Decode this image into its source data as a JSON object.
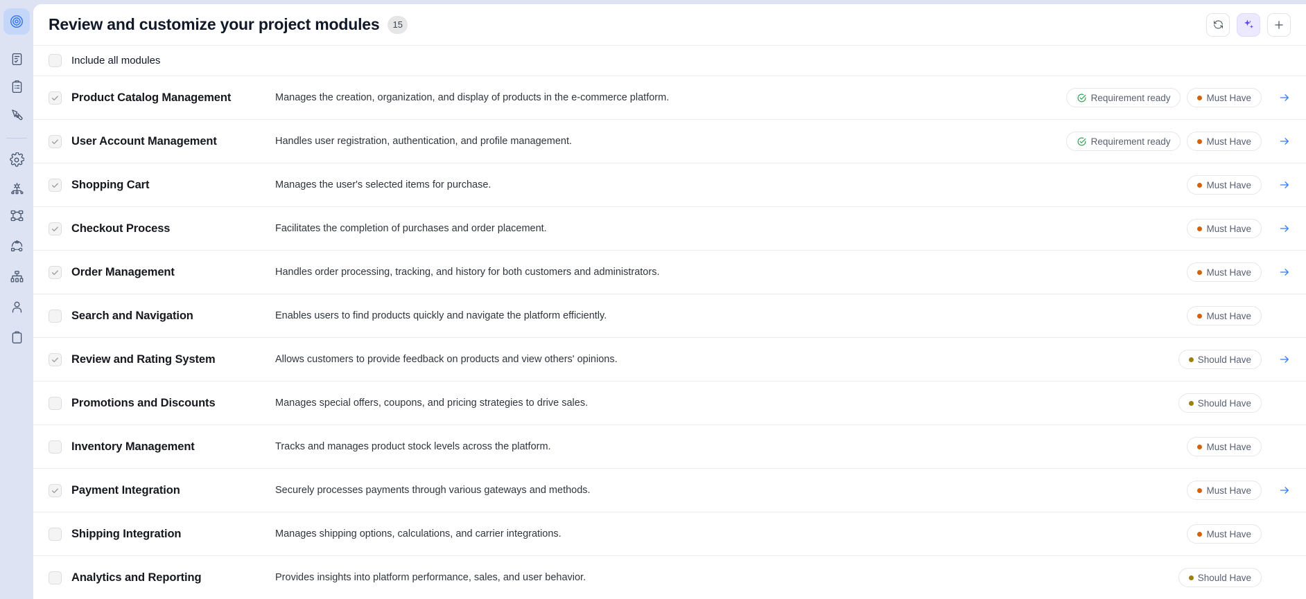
{
  "sidebar": {
    "items": [
      {
        "name": "target-icon",
        "label": "Project Overview",
        "active": true
      },
      {
        "name": "document-check-icon",
        "label": "Requirements",
        "active": false
      },
      {
        "name": "clipboard-list-icon",
        "label": "Tasks",
        "active": false
      },
      {
        "name": "design-pen-icon",
        "label": "Design",
        "active": false
      },
      {
        "name": "gear-icon",
        "label": "Settings",
        "active": false
      },
      {
        "name": "gear-network-icon",
        "label": "Integrations",
        "active": false
      },
      {
        "name": "sitemap-icon",
        "label": "Architecture",
        "active": false
      },
      {
        "name": "shapes-flow-icon",
        "label": "Workflow",
        "active": false
      },
      {
        "name": "org-chart-icon",
        "label": "Hierarchy",
        "active": false
      },
      {
        "name": "user-icon",
        "label": "Account",
        "active": false
      },
      {
        "name": "clipboard-icon",
        "label": "Notes",
        "active": false
      }
    ]
  },
  "header": {
    "title": "Review and customize your project modules",
    "count": "15",
    "actions": [
      {
        "name": "refresh-button",
        "icon": "refresh-icon",
        "label": "Regenerate",
        "accent": false
      },
      {
        "name": "ai-button",
        "icon": "sparkles-icon",
        "label": "AI assist",
        "accent": true
      },
      {
        "name": "add-button",
        "icon": "plus-icon",
        "label": "Add module",
        "accent": false
      }
    ]
  },
  "select_all": {
    "label": "Include all modules",
    "checked": false
  },
  "priority_colors": {
    "must_have": "#d3620e",
    "should_have": "#9c7f10",
    "ready_check": "#2e9e4f"
  },
  "modules": [
    {
      "name": "Product Catalog Management",
      "description": "Manages the creation, organization, and display of products in the e-commerce platform.",
      "checked": true,
      "status": "Requirement ready",
      "priority": "Must Have",
      "priority_kind": "must",
      "has_arrow": true
    },
    {
      "name": "User Account Management",
      "description": "Handles user registration, authentication, and profile management.",
      "checked": true,
      "status": "Requirement ready",
      "priority": "Must Have",
      "priority_kind": "must",
      "has_arrow": true
    },
    {
      "name": "Shopping Cart",
      "description": "Manages the user's selected items for purchase.",
      "checked": true,
      "status": "",
      "priority": "Must Have",
      "priority_kind": "must",
      "has_arrow": true
    },
    {
      "name": "Checkout Process",
      "description": "Facilitates the completion of purchases and order placement.",
      "checked": true,
      "status": "",
      "priority": "Must Have",
      "priority_kind": "must",
      "has_arrow": true
    },
    {
      "name": "Order Management",
      "description": "Handles order processing, tracking, and history for both customers and administrators.",
      "checked": true,
      "status": "",
      "priority": "Must Have",
      "priority_kind": "must",
      "has_arrow": true
    },
    {
      "name": "Search and Navigation",
      "description": "Enables users to find products quickly and navigate the platform efficiently.",
      "checked": false,
      "status": "",
      "priority": "Must Have",
      "priority_kind": "must",
      "has_arrow": false
    },
    {
      "name": "Review and Rating System",
      "description": "Allows customers to provide feedback on products and view others' opinions.",
      "checked": true,
      "status": "",
      "priority": "Should Have",
      "priority_kind": "should",
      "has_arrow": true
    },
    {
      "name": "Promotions and Discounts",
      "description": "Manages special offers, coupons, and pricing strategies to drive sales.",
      "checked": false,
      "status": "",
      "priority": "Should Have",
      "priority_kind": "should",
      "has_arrow": false
    },
    {
      "name": "Inventory Management",
      "description": "Tracks and manages product stock levels across the platform.",
      "checked": false,
      "status": "",
      "priority": "Must Have",
      "priority_kind": "must",
      "has_arrow": false
    },
    {
      "name": "Payment Integration",
      "description": "Securely processes payments through various gateways and methods.",
      "checked": true,
      "status": "",
      "priority": "Must Have",
      "priority_kind": "must",
      "has_arrow": true
    },
    {
      "name": "Shipping Integration",
      "description": "Manages shipping options, calculations, and carrier integrations.",
      "checked": false,
      "status": "",
      "priority": "Must Have",
      "priority_kind": "must",
      "has_arrow": false
    },
    {
      "name": "Analytics and Reporting",
      "description": "Provides insights into platform performance, sales, and user behavior.",
      "checked": false,
      "status": "",
      "priority": "Should Have",
      "priority_kind": "should",
      "has_arrow": false
    }
  ]
}
